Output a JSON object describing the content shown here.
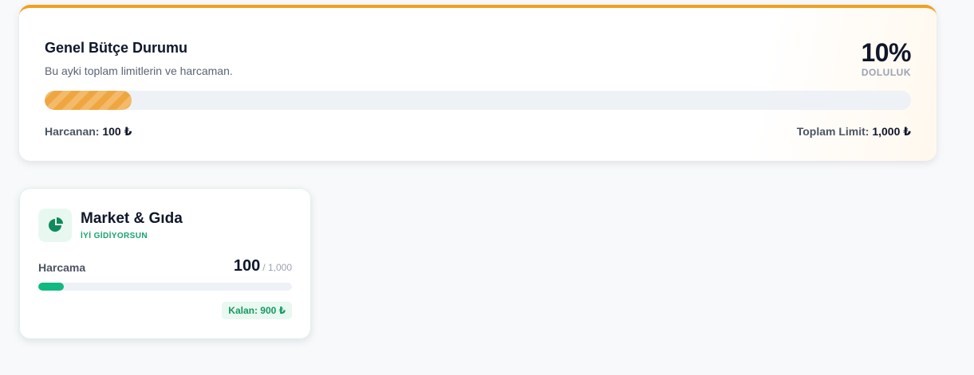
{
  "overview": {
    "title": "Genel Bütçe Durumu",
    "subtitle": "Bu ayki toplam limitlerin ve harcaman.",
    "percent_text": "10%",
    "percent_label": "DOLULUK",
    "fill_fraction": 0.1,
    "spent_label": "Harcanan:",
    "spent_value": "100 ₺",
    "limit_label": "Toplam Limit:",
    "limit_value": "1,000 ₺",
    "accent_color": "#f0a020"
  },
  "categories": [
    {
      "name": "Market & Gıda",
      "status": "İYİ GİDİYORSUN",
      "icon": "pie-chart-icon",
      "spend_label": "Harcama",
      "spent": "100",
      "limit": "/ 1,000",
      "fill_fraction": 0.1,
      "remaining": "Kalan: 900 ₺",
      "color": "#10b981"
    }
  ]
}
